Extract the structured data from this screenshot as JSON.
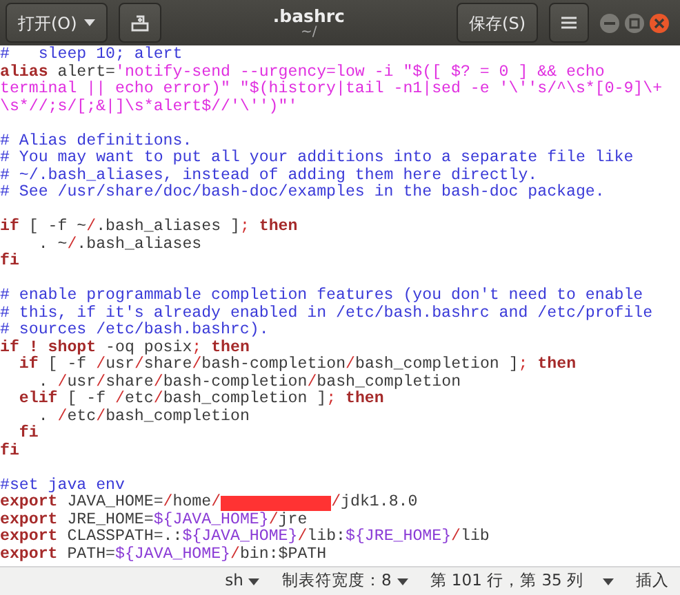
{
  "window": {
    "title": ".bashrc",
    "subtitle": "~/"
  },
  "header": {
    "open_button": "打开(O)",
    "save_button": "保存(S)"
  },
  "editor": {
    "lines": [
      {
        "kind": "code",
        "tokens": [
          {
            "kind": "comment",
            "text": "#   sleep 10; alert"
          }
        ]
      },
      {
        "kind": "code",
        "tokens": [
          {
            "kind": "keyword",
            "text": "alias"
          },
          {
            "kind": "plain",
            "text": " alert="
          },
          {
            "kind": "string",
            "text": "'notify-send --urgency=low -i \"$([ $? = 0 ] && echo"
          }
        ]
      },
      {
        "kind": "code",
        "tokens": [
          {
            "kind": "string",
            "text": "terminal || echo error)\" \"$(history|tail -n1|sed -e '\\''s/^\\s*[0-9]\\+"
          }
        ]
      },
      {
        "kind": "code",
        "tokens": [
          {
            "kind": "string",
            "text": "\\s*//;s/[;&|]\\s*alert$//'\\'')\"'"
          }
        ]
      },
      {
        "kind": "blank"
      },
      {
        "kind": "code",
        "tokens": [
          {
            "kind": "comment",
            "text": "# Alias definitions."
          }
        ]
      },
      {
        "kind": "code",
        "tokens": [
          {
            "kind": "comment",
            "text": "# You may want to put all your additions into a separate file like"
          }
        ]
      },
      {
        "kind": "code",
        "tokens": [
          {
            "kind": "comment",
            "text": "# ~/.bash_aliases, instead of adding them here directly."
          }
        ]
      },
      {
        "kind": "code",
        "tokens": [
          {
            "kind": "comment",
            "text": "# See /usr/share/doc/bash-doc/examples in the bash-doc package."
          }
        ]
      },
      {
        "kind": "blank"
      },
      {
        "kind": "code",
        "tokens": [
          {
            "kind": "keyword",
            "text": "if"
          },
          {
            "kind": "plain",
            "text": " [ -f ~"
          },
          {
            "kind": "operator",
            "text": "/"
          },
          {
            "kind": "plain",
            "text": ".bash_aliases ]"
          },
          {
            "kind": "operator",
            "text": "; "
          },
          {
            "kind": "keyword",
            "text": "then"
          }
        ]
      },
      {
        "kind": "code",
        "tokens": [
          {
            "kind": "plain",
            "text": "    . ~"
          },
          {
            "kind": "operator",
            "text": "/"
          },
          {
            "kind": "plain",
            "text": ".bash_aliases"
          }
        ]
      },
      {
        "kind": "code",
        "tokens": [
          {
            "kind": "keyword",
            "text": "fi"
          }
        ]
      },
      {
        "kind": "blank"
      },
      {
        "kind": "code",
        "tokens": [
          {
            "kind": "comment",
            "text": "# enable programmable completion features (you don't need to enable"
          }
        ]
      },
      {
        "kind": "code",
        "tokens": [
          {
            "kind": "comment",
            "text": "# this, if it's already enabled in /etc/bash.bashrc and /etc/profile"
          }
        ]
      },
      {
        "kind": "code",
        "tokens": [
          {
            "kind": "comment",
            "text": "# sources /etc/bash.bashrc)."
          }
        ]
      },
      {
        "kind": "code",
        "tokens": [
          {
            "kind": "keyword",
            "text": "if ! shopt"
          },
          {
            "kind": "plain",
            "text": " -oq posix"
          },
          {
            "kind": "operator",
            "text": "; "
          },
          {
            "kind": "keyword",
            "text": "then"
          }
        ]
      },
      {
        "kind": "code",
        "tokens": [
          {
            "kind": "keyword",
            "text": "  if"
          },
          {
            "kind": "plain",
            "text": " [ -f "
          },
          {
            "kind": "operator",
            "text": "/"
          },
          {
            "kind": "plain",
            "text": "usr"
          },
          {
            "kind": "operator",
            "text": "/"
          },
          {
            "kind": "plain",
            "text": "share"
          },
          {
            "kind": "operator",
            "text": "/"
          },
          {
            "kind": "plain",
            "text": "bash-completion"
          },
          {
            "kind": "operator",
            "text": "/"
          },
          {
            "kind": "plain",
            "text": "bash_completion ]"
          },
          {
            "kind": "operator",
            "text": "; "
          },
          {
            "kind": "keyword",
            "text": "then"
          }
        ]
      },
      {
        "kind": "code",
        "tokens": [
          {
            "kind": "plain",
            "text": "    . "
          },
          {
            "kind": "operator",
            "text": "/"
          },
          {
            "kind": "plain",
            "text": "usr"
          },
          {
            "kind": "operator",
            "text": "/"
          },
          {
            "kind": "plain",
            "text": "share"
          },
          {
            "kind": "operator",
            "text": "/"
          },
          {
            "kind": "plain",
            "text": "bash-completion"
          },
          {
            "kind": "operator",
            "text": "/"
          },
          {
            "kind": "plain",
            "text": "bash_completion"
          }
        ]
      },
      {
        "kind": "code",
        "tokens": [
          {
            "kind": "keyword",
            "text": "  elif"
          },
          {
            "kind": "plain",
            "text": " [ -f "
          },
          {
            "kind": "operator",
            "text": "/"
          },
          {
            "kind": "plain",
            "text": "etc"
          },
          {
            "kind": "operator",
            "text": "/"
          },
          {
            "kind": "plain",
            "text": "bash_completion ]"
          },
          {
            "kind": "operator",
            "text": "; "
          },
          {
            "kind": "keyword",
            "text": "then"
          }
        ]
      },
      {
        "kind": "code",
        "tokens": [
          {
            "kind": "plain",
            "text": "    . "
          },
          {
            "kind": "operator",
            "text": "/"
          },
          {
            "kind": "plain",
            "text": "etc"
          },
          {
            "kind": "operator",
            "text": "/"
          },
          {
            "kind": "plain",
            "text": "bash_completion"
          }
        ]
      },
      {
        "kind": "code",
        "tokens": [
          {
            "kind": "keyword",
            "text": "  fi"
          }
        ]
      },
      {
        "kind": "code",
        "tokens": [
          {
            "kind": "keyword",
            "text": "fi"
          }
        ]
      },
      {
        "kind": "blank"
      },
      {
        "kind": "code",
        "tokens": [
          {
            "kind": "comment",
            "text": "#set java env"
          }
        ]
      },
      {
        "kind": "code",
        "tokens": [
          {
            "kind": "keyword",
            "text": "export"
          },
          {
            "kind": "plain",
            "text": " JAVA_HOME="
          },
          {
            "kind": "operator",
            "text": "/"
          },
          {
            "kind": "plain",
            "text": "home"
          },
          {
            "kind": "operator",
            "text": "/"
          },
          {
            "kind": "redacted"
          },
          {
            "kind": "operator",
            "text": "/"
          },
          {
            "kind": "plain",
            "text": "jdk1.8.0"
          }
        ]
      },
      {
        "kind": "code",
        "tokens": [
          {
            "kind": "keyword",
            "text": "export"
          },
          {
            "kind": "plain",
            "text": " JRE_HOME="
          },
          {
            "kind": "variable",
            "text": "${JAVA_HOME}"
          },
          {
            "kind": "operator",
            "text": "/"
          },
          {
            "kind": "plain",
            "text": "jre"
          }
        ]
      },
      {
        "kind": "code",
        "tokens": [
          {
            "kind": "keyword",
            "text": "export"
          },
          {
            "kind": "plain",
            "text": " CLASSPATH=.:"
          },
          {
            "kind": "variable",
            "text": "${JAVA_HOME}"
          },
          {
            "kind": "operator",
            "text": "/"
          },
          {
            "kind": "plain",
            "text": "lib:"
          },
          {
            "kind": "variable",
            "text": "${JRE_HOME}"
          },
          {
            "kind": "operator",
            "text": "/"
          },
          {
            "kind": "plain",
            "text": "lib"
          }
        ]
      },
      {
        "kind": "code",
        "tokens": [
          {
            "kind": "keyword",
            "text": "export"
          },
          {
            "kind": "plain",
            "text": " PATH="
          },
          {
            "kind": "variable",
            "text": "${JAVA_HOME}"
          },
          {
            "kind": "operator",
            "text": "/"
          },
          {
            "kind": "plain",
            "text": "bin:$PATH"
          }
        ]
      }
    ]
  },
  "status_bar": {
    "language": "sh",
    "tab_width": "制表符宽度：8",
    "position": "第 101 行，第 35 列",
    "mode": "插入"
  }
}
